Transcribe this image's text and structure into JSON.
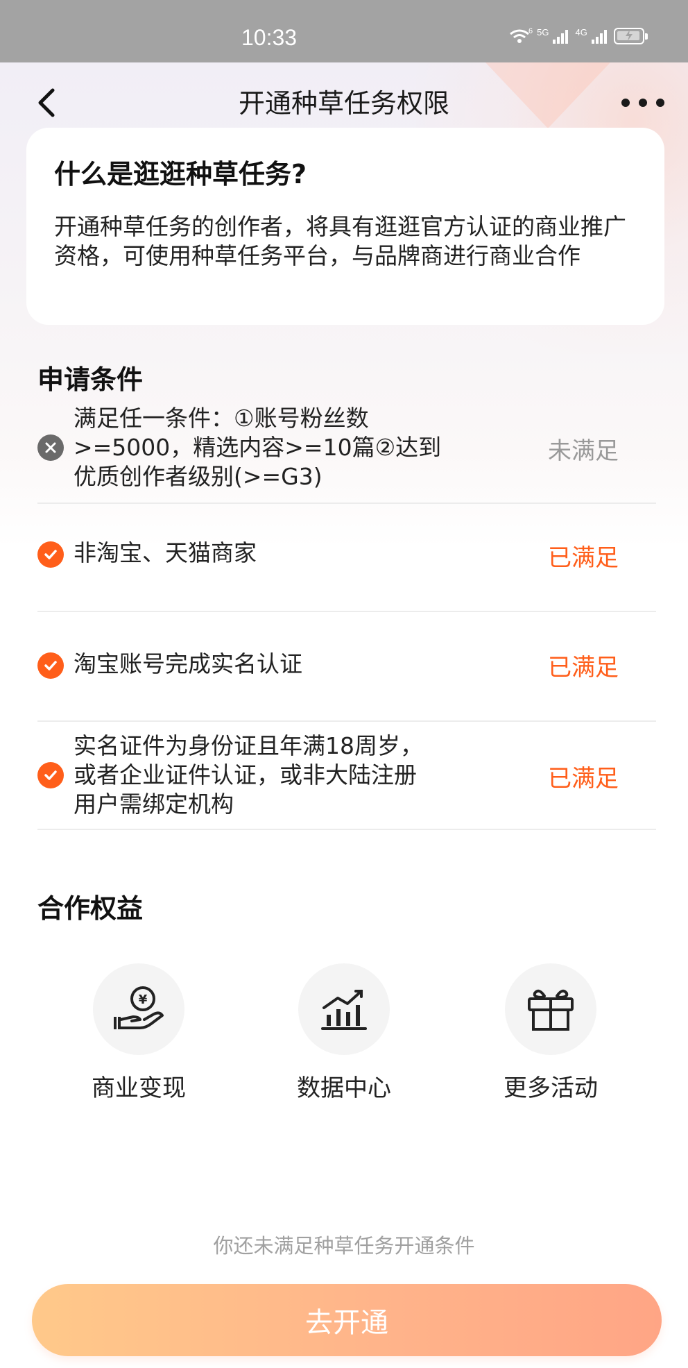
{
  "status_bar": {
    "time": "10:33",
    "network_1": "5G",
    "network_2": "4G",
    "wifi_badge": "6"
  },
  "nav": {
    "title": "开通种草任务权限",
    "back_icon": "chevron-left-icon",
    "more_icon": "more-dots-icon"
  },
  "intro": {
    "title": "什么是逛逛种草任务?",
    "description": "开通种草任务的创作者，将具有逛逛官方认证的商业推广资格，可使用种草任务平台，与品牌商进行商业合作"
  },
  "conditions": {
    "title": "申请条件",
    "items": [
      {
        "text": "满足任一条件：①账号粉丝数>=5000，精选内容>=10篇②达到优质创作者级别(>=G3)",
        "status": "未满足",
        "met": false
      },
      {
        "text": "非淘宝、天猫商家",
        "status": "已满足",
        "met": true
      },
      {
        "text": "淘宝账号完成实名认证",
        "status": "已满足",
        "met": true
      },
      {
        "text": "实名证件为身份证且年满18周岁，或者企业证件认证，或非大陆注册用户需绑定机构",
        "status": "已满足",
        "met": true
      }
    ]
  },
  "benefits": {
    "title": "合作权益",
    "items": [
      {
        "label": "商业变现",
        "icon": "hand-coin-icon"
      },
      {
        "label": "数据中心",
        "icon": "bar-chart-icon"
      },
      {
        "label": "更多活动",
        "icon": "gift-icon"
      }
    ]
  },
  "footer": {
    "hint": "你还未满足种草任务开通条件",
    "cta_label": "去开通"
  },
  "colors": {
    "accent": "#ff5e1a",
    "cta_gradient_start": "#ffc98a",
    "cta_gradient_end": "#ffa585",
    "status_bar": "#a3a3a3"
  }
}
